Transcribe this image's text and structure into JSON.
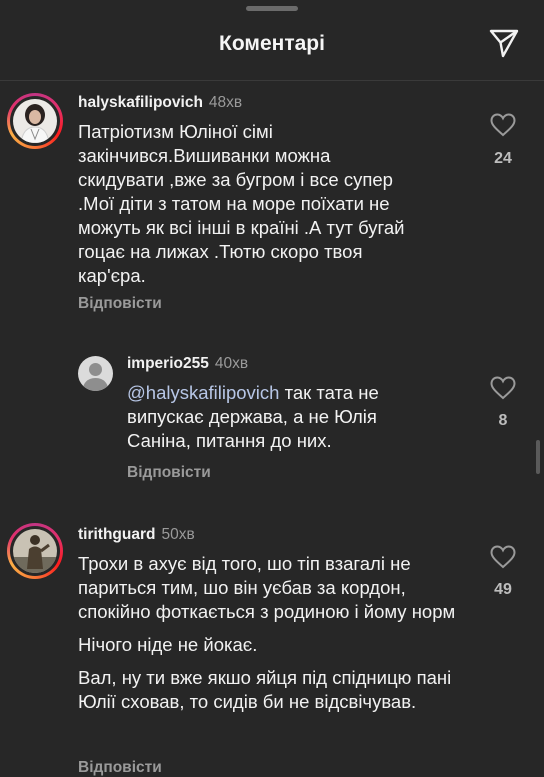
{
  "header": {
    "title": "Коментарі",
    "send_icon": "send-icon"
  },
  "comments": [
    {
      "username": "halyskafilipovich",
      "time": "48хв",
      "paragraphs": [
        "Патріотизм Юліної сімі закінчився.Вишиванки можна скидувати ,вже за бугром і все супер .Мої діти з татом на море поїхати не можуть як всі інші в країні .А тут бугай гоцає на лижах .Тютю скоро твоя кар'єра."
      ],
      "reply_label": "Відповісти",
      "likes": "24"
    },
    {
      "username": "imperio255",
      "time": "40хв",
      "mention": "@halyskafilipovich",
      "text": " так тата не випускає держава, а не Юлія Саніна, питання до них.",
      "reply_label": "Відповісти",
      "likes": "8"
    },
    {
      "username": "tirithguard",
      "time": "50хв",
      "paragraphs": [
        "Трохи в ахує від того, шо тіп взагалі не париться тим, шо він уєбав за кордон, спокійно фоткається з родиною і йому норм",
        "Нічого ніде не йокає.",
        "Вал, ну ти вже якшо яйця під спідницю пані Юлії сховав, то сидів би не відсвічував."
      ],
      "reply_label": "Відповісти",
      "likes": "49"
    }
  ],
  "colors": {
    "background": "#272727",
    "text": "#f2f2f2",
    "muted": "#9a9a9a",
    "mention": "#b7c6e6"
  }
}
